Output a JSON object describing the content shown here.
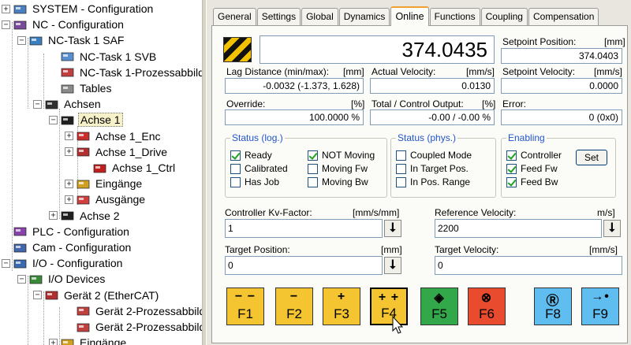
{
  "tree": {
    "items": [
      {
        "label": "SYSTEM - Configuration",
        "exp": "+",
        "icon": "system-config-icon"
      },
      {
        "label": "NC - Configuration",
        "exp": "−",
        "icon": "nc-config-icon"
      },
      {
        "label": "NC-Task 1 SAF",
        "exp": "−",
        "icon": "nc-task-icon"
      },
      {
        "label": "NC-Task 1 SVB",
        "exp": "",
        "icon": "task-svb-icon"
      },
      {
        "label": "NC-Task 1-Prozessabbild",
        "exp": "",
        "icon": "process-image-icon"
      },
      {
        "label": "Tables",
        "exp": "",
        "icon": "tables-icon"
      },
      {
        "label": "Achsen",
        "exp": "−",
        "icon": "axes-icon"
      },
      {
        "label": "Achse 1",
        "exp": "−",
        "icon": "axis-icon"
      },
      {
        "label": "Achse 1_Enc",
        "exp": "+",
        "icon": "encoder-icon"
      },
      {
        "label": "Achse 1_Drive",
        "exp": "+",
        "icon": "drive-icon"
      },
      {
        "label": "Achse 1_Ctrl",
        "exp": "",
        "icon": "controller-icon"
      },
      {
        "label": "Eingänge",
        "exp": "+",
        "icon": "inputs-icon"
      },
      {
        "label": "Ausgänge",
        "exp": "+",
        "icon": "outputs-icon"
      },
      {
        "label": "Achse 2",
        "exp": "+",
        "icon": "axis-icon"
      },
      {
        "label": "PLC - Configuration",
        "exp": "",
        "icon": "plc-config-icon"
      },
      {
        "label": "Cam - Configuration",
        "exp": "",
        "icon": "cam-config-icon"
      },
      {
        "label": "I/O - Configuration",
        "exp": "−",
        "icon": "io-config-icon"
      },
      {
        "label": "I/O Devices",
        "exp": "−",
        "icon": "io-devices-icon"
      },
      {
        "label": "Gerät 2 (EtherCAT)",
        "exp": "−",
        "icon": "ethercat-icon"
      },
      {
        "label": "Gerät 2-Prozessabbild",
        "exp": "",
        "icon": "process-image-icon"
      },
      {
        "label": "Gerät 2-Prozessabbild",
        "exp": "",
        "icon": "process-image-icon"
      },
      {
        "label": "Eingänge",
        "exp": "+",
        "icon": "inputs-icon"
      }
    ]
  },
  "tabs": [
    "General",
    "Settings",
    "Global",
    "Dynamics",
    "Online",
    "Functions",
    "Coupling",
    "Compensation"
  ],
  "active_tab": "Online",
  "online": {
    "position_value": "374.0435",
    "setpoint_position": {
      "label": "Setpoint Position:",
      "unit": "[mm]",
      "value": "374.0403"
    },
    "lag_distance": {
      "label": "Lag Distance (min/max):",
      "unit": "[mm]",
      "value": "-0.0032  (-1.373, 1.628)"
    },
    "actual_velocity": {
      "label": "Actual Velocity:",
      "unit": "[mm/s]",
      "value": "0.0130"
    },
    "setpoint_velocity": {
      "label": "Setpoint Velocity:",
      "unit": "[mm/s]",
      "value": "0.0000"
    },
    "override": {
      "label": "Override:",
      "unit": "[%]",
      "value": "100.0000 %"
    },
    "total_output": {
      "label": "Total / Control Output:",
      "unit": "[%]",
      "value": "-0.00 / -0.00 %"
    },
    "error": {
      "label": "Error:",
      "value": "0 (0x0)"
    }
  },
  "status_log": {
    "title": "Status (log.)",
    "items": [
      {
        "label": "Ready",
        "checked": true
      },
      {
        "label": "Calibrated",
        "checked": false
      },
      {
        "label": "Has Job",
        "checked": false
      },
      {
        "label": "NOT Moving",
        "checked": true
      },
      {
        "label": "Moving Fw",
        "checked": false
      },
      {
        "label": "Moving Bw",
        "checked": false
      }
    ]
  },
  "status_phys": {
    "title": "Status (phys.)",
    "items": [
      {
        "label": "Coupled Mode",
        "checked": false
      },
      {
        "label": "In Target Pos.",
        "checked": false
      },
      {
        "label": "In Pos. Range",
        "checked": false
      }
    ]
  },
  "enabling": {
    "title": "Enabling",
    "items": [
      {
        "label": "Controller",
        "checked": true
      },
      {
        "label": "Feed Fw",
        "checked": true
      },
      {
        "label": "Feed Bw",
        "checked": true
      }
    ],
    "set_label": "Set"
  },
  "controller_kv": {
    "label": "Controller Kv-Factor:",
    "unit": "[mm/s/mm]",
    "value": "1"
  },
  "reference_velocity": {
    "label": "Reference Velocity:",
    "unit": "m/s]",
    "value": "2200"
  },
  "target_position": {
    "label": "Target Position:",
    "unit": "[mm]",
    "value": "0"
  },
  "target_velocity": {
    "label": "Target Velocity:",
    "unit": "[mm/s]",
    "value": "0"
  },
  "fkeys": [
    {
      "sym": "− −",
      "key": "F1",
      "color": "#f4c531",
      "icon": "fast-backward-icon"
    },
    {
      "sym": "−",
      "key": "F2",
      "color": "#f4c531",
      "icon": "backward-icon"
    },
    {
      "sym": "+",
      "key": "F3",
      "color": "#f4c531",
      "icon": "forward-icon"
    },
    {
      "sym": "+ +",
      "key": "F4",
      "color": "#f4c531",
      "icon": "fast-forward-icon"
    },
    {
      "sym": "◈",
      "key": "F5",
      "color": "#33a84a",
      "icon": "start-icon"
    },
    {
      "sym": "⊗",
      "key": "F6",
      "color": "#e94b2e",
      "icon": "stop-icon"
    },
    {
      "sym": "Ⓡ",
      "key": "F8",
      "color": "#5fbdf0",
      "icon": "reset-icon"
    },
    {
      "sym": "→•",
      "key": "F9",
      "color": "#5fbdf0",
      "icon": "home-icon"
    }
  ],
  "colors": {
    "accent_tab": "#f0a030",
    "status_blue": "#2255cc",
    "fkey_yellow": "#f4c531",
    "fkey_green": "#33a84a",
    "fkey_red": "#e94b2e",
    "fkey_blue": "#5fbdf0"
  }
}
